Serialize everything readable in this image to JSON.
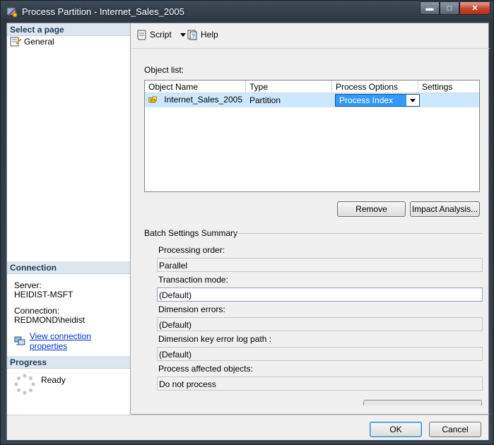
{
  "window": {
    "title": "Process Partition - Internet_Sales_2005"
  },
  "left_pane": {
    "select_page_header": "Select a page",
    "pages": [
      {
        "label": "General",
        "icon": "page-icon"
      }
    ],
    "connection_header": "Connection",
    "server_label": "Server:",
    "server_value": "HEIDIST-MSFT",
    "connection_label": "Connection:",
    "connection_value": "REDMOND\\heidist",
    "view_connection_link": "View connection properties",
    "progress_header": "Progress",
    "progress_status": "Ready"
  },
  "toolbar": {
    "script_label": "Script",
    "help_label": "Help"
  },
  "object_list": {
    "label": "Object list:",
    "columns": [
      "Object Name",
      "Type",
      "Process Options",
      "Settings"
    ],
    "rows": [
      {
        "name": "Internet_Sales_2005",
        "type": "Partition",
        "process_option": "Process Index",
        "settings": ""
      }
    ]
  },
  "buttons": {
    "remove": "Remove",
    "impact_analysis": "Impact Analysis...",
    "ok": "OK",
    "cancel": "Cancel"
  },
  "batch_settings": {
    "title": "Batch Settings Summary",
    "processing_order_label": "Processing order:",
    "processing_order_value": "Parallel",
    "transaction_mode_label": "Transaction mode:",
    "transaction_mode_value": "(Default)",
    "dimension_errors_label": "Dimension errors:",
    "dimension_errors_value": "(Default)",
    "dimension_key_log_label": "Dimension key error log path :",
    "dimension_key_log_value": "(Default)",
    "process_affected_label": "Process affected objects:",
    "process_affected_value": "Do not process"
  },
  "colors": {
    "selection": "#cce8ff",
    "combo_highlight": "#3399ff",
    "link": "#0033cc",
    "header_band": "#dde6ee"
  }
}
